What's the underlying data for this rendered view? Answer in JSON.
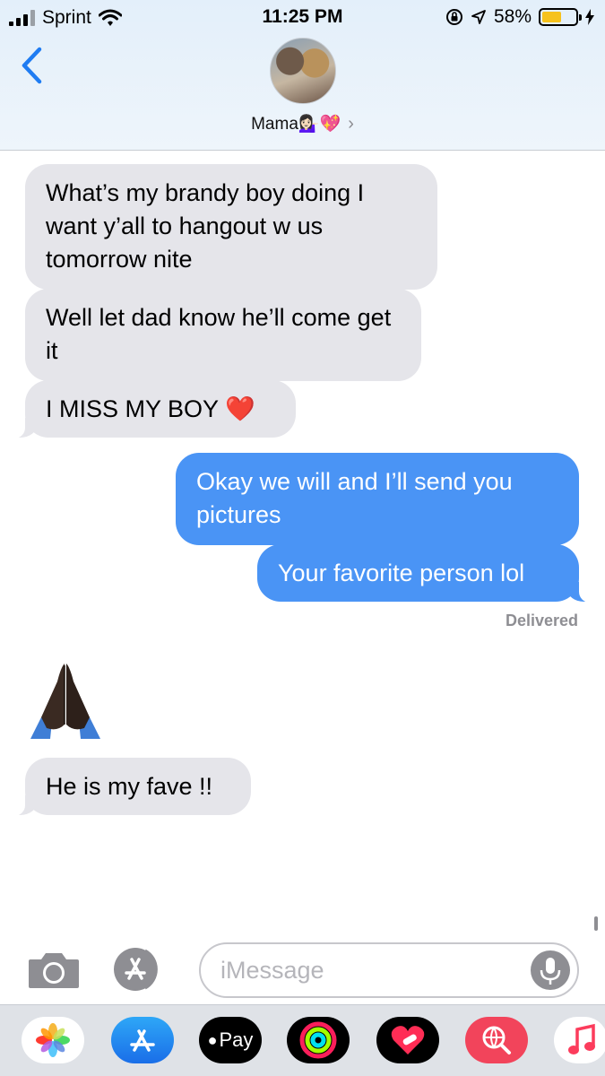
{
  "status_bar": {
    "carrier": "Sprint",
    "time": "11:25 PM",
    "battery": "58%",
    "battery_level": 0.58
  },
  "header": {
    "contact_name": "Mama",
    "contact_emoji": "💁🏻‍♀️💖",
    "chevron": "›"
  },
  "messages": [
    {
      "side": "incoming",
      "text": "What’s my brandy boy doing I want y’all to hangout w us tomorrow nite"
    },
    {
      "side": "incoming",
      "text": "Well let dad know he’ll come get it"
    },
    {
      "side": "incoming",
      "text": "I MISS MY BOY ❤️"
    },
    {
      "side": "outgoing",
      "text": "Okay we will and I’ll send you pictures"
    },
    {
      "side": "outgoing",
      "text": "Your favorite person lol"
    },
    {
      "side": "incoming",
      "icon": "praying-hands-icon"
    },
    {
      "side": "incoming",
      "text": "He is my fave !!"
    }
  ],
  "delivered_label": "Delivered",
  "composer": {
    "placeholder": "iMessage"
  },
  "apps": [
    {
      "name": "photos-app-icon"
    },
    {
      "name": "app-store-icon"
    },
    {
      "name": "apple-pay-icon",
      "label": "Pay"
    },
    {
      "name": "activity-icon"
    },
    {
      "name": "heart-app-icon"
    },
    {
      "name": "web-search-icon"
    },
    {
      "name": "music-icon"
    }
  ],
  "colors": {
    "incoming_bubble": "#e5e5ea",
    "outgoing_bubble": "#4a94f5",
    "accent": "#1f7cf2"
  }
}
